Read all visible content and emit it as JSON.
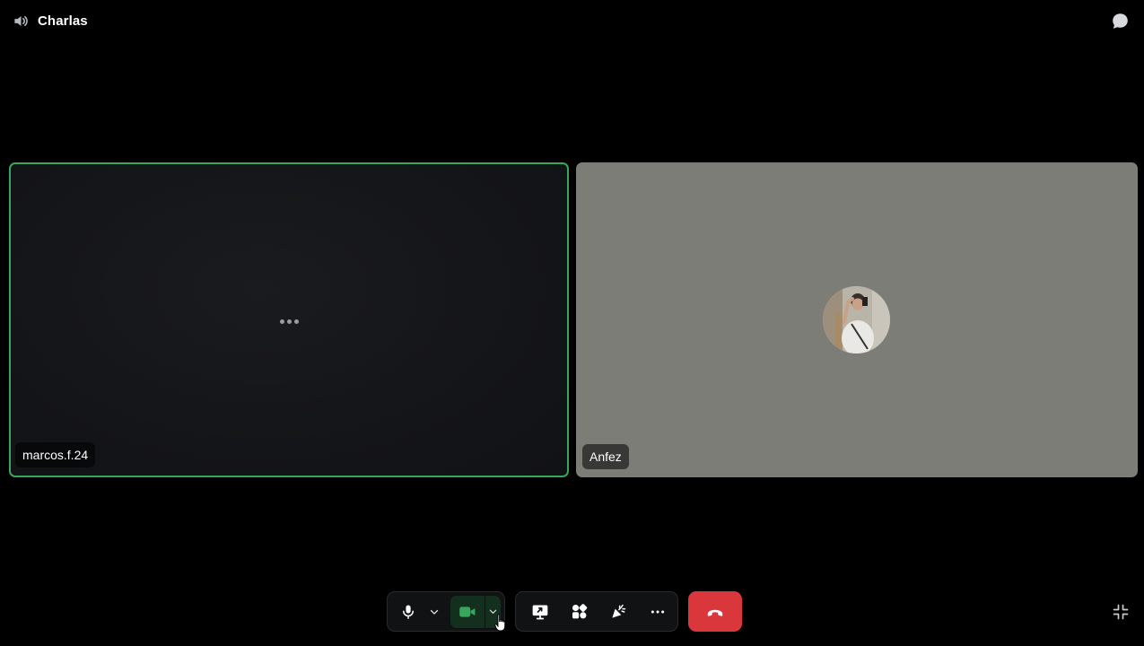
{
  "channel": {
    "name": "Charlas",
    "icon": "speaker-icon"
  },
  "header": {
    "chat_icon": "chat-bubble-icon"
  },
  "participants": [
    {
      "name": "marcos.f.24",
      "state": "loading",
      "speaking": true,
      "accent_color": "#3aa55c"
    },
    {
      "name": "Anfez",
      "state": "avatar",
      "tile_color": "#7d7d78"
    }
  ],
  "controls": {
    "microphone_icon": "microphone-icon",
    "microphone_options_icon": "chevron-down-icon",
    "camera_icon": "video-camera-icon",
    "camera_on": true,
    "camera_color": "#3aa55c",
    "camera_options_icon": "chevron-down-icon",
    "screen_share_icon": "screen-share-icon",
    "activities_icon": "activities-icon",
    "soundboard_icon": "soundboard-icon",
    "more_icon": "more-dots-icon",
    "disconnect_icon": "phone-hangup-icon",
    "disconnect_color": "#da373c",
    "fullscreen_icon": "exit-fullscreen-icon"
  }
}
